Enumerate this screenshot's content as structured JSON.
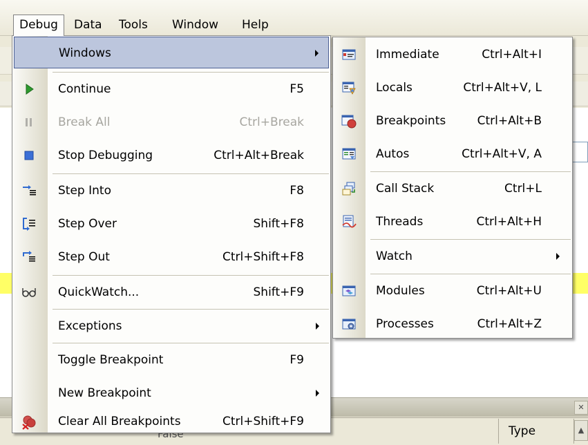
{
  "menubar": {
    "items": [
      "Debug",
      "Data",
      "Tools",
      "Window",
      "Help"
    ]
  },
  "background": {
    "column_header_type": "Type",
    "partial_grid_value": "False"
  },
  "debug_menu": {
    "windows": {
      "label": "Windows",
      "icon": "none"
    },
    "continue": {
      "label": "Continue",
      "shortcut": "F5",
      "icon": "play-icon"
    },
    "break_all": {
      "label": "Break All",
      "shortcut": "Ctrl+Break",
      "icon": "pause-icon",
      "disabled": true
    },
    "stop_debugging": {
      "label": "Stop Debugging",
      "shortcut": "Ctrl+Alt+Break",
      "icon": "stop-icon"
    },
    "step_into": {
      "label": "Step Into",
      "shortcut": "F8",
      "icon": "step-into-icon"
    },
    "step_over": {
      "label": "Step Over",
      "shortcut": "Shift+F8",
      "icon": "step-over-icon"
    },
    "step_out": {
      "label": "Step Out",
      "shortcut": "Ctrl+Shift+F8",
      "icon": "step-out-icon"
    },
    "quickwatch": {
      "label": "QuickWatch...",
      "shortcut": "Shift+F9",
      "icon": "glasses-icon"
    },
    "exceptions": {
      "label": "Exceptions"
    },
    "toggle_breakpoint": {
      "label": "Toggle Breakpoint",
      "shortcut": "F9"
    },
    "new_breakpoint": {
      "label": "New Breakpoint"
    },
    "clear_all_breakpoints": {
      "label": "Clear All Breakpoints",
      "shortcut": "Ctrl+Shift+F9",
      "icon": "clear-breakpoints-icon"
    }
  },
  "windows_menu": {
    "immediate": {
      "label": "Immediate",
      "shortcut": "Ctrl+Alt+I"
    },
    "locals": {
      "label": "Locals",
      "shortcut": "Ctrl+Alt+V, L"
    },
    "breakpoints": {
      "label": "Breakpoints",
      "shortcut": "Ctrl+Alt+B"
    },
    "autos": {
      "label": "Autos",
      "shortcut": "Ctrl+Alt+V, A"
    },
    "call_stack": {
      "label": "Call Stack",
      "shortcut": "Ctrl+L"
    },
    "threads": {
      "label": "Threads",
      "shortcut": "Ctrl+Alt+H"
    },
    "watch": {
      "label": "Watch"
    },
    "modules": {
      "label": "Modules",
      "shortcut": "Ctrl+Alt+U"
    },
    "processes": {
      "label": "Processes",
      "shortcut": "Ctrl+Alt+Z"
    }
  },
  "colors": {
    "highlight": "#bcc6dd",
    "highlight_border": "#4b5f95",
    "disabled_text": "#a7a6a0"
  }
}
